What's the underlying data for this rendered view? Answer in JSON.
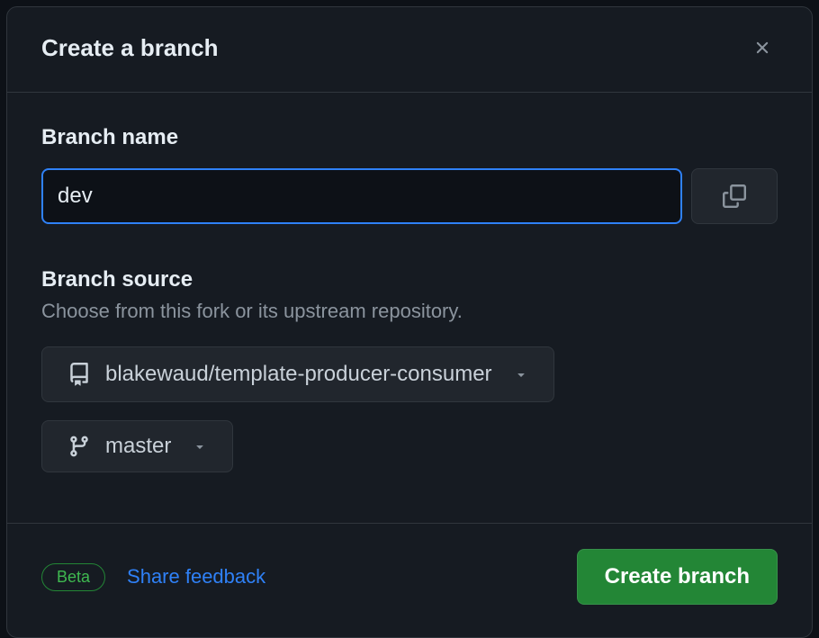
{
  "dialog": {
    "title": "Create a branch",
    "branch_name": {
      "label": "Branch name",
      "value": "dev"
    },
    "branch_source": {
      "label": "Branch source",
      "description": "Choose from this fork or its upstream repository.",
      "repository": "blakewaud/template-producer-consumer",
      "branch": "master"
    },
    "footer": {
      "beta_label": "Beta",
      "feedback_label": "Share feedback",
      "create_button_label": "Create branch"
    }
  }
}
